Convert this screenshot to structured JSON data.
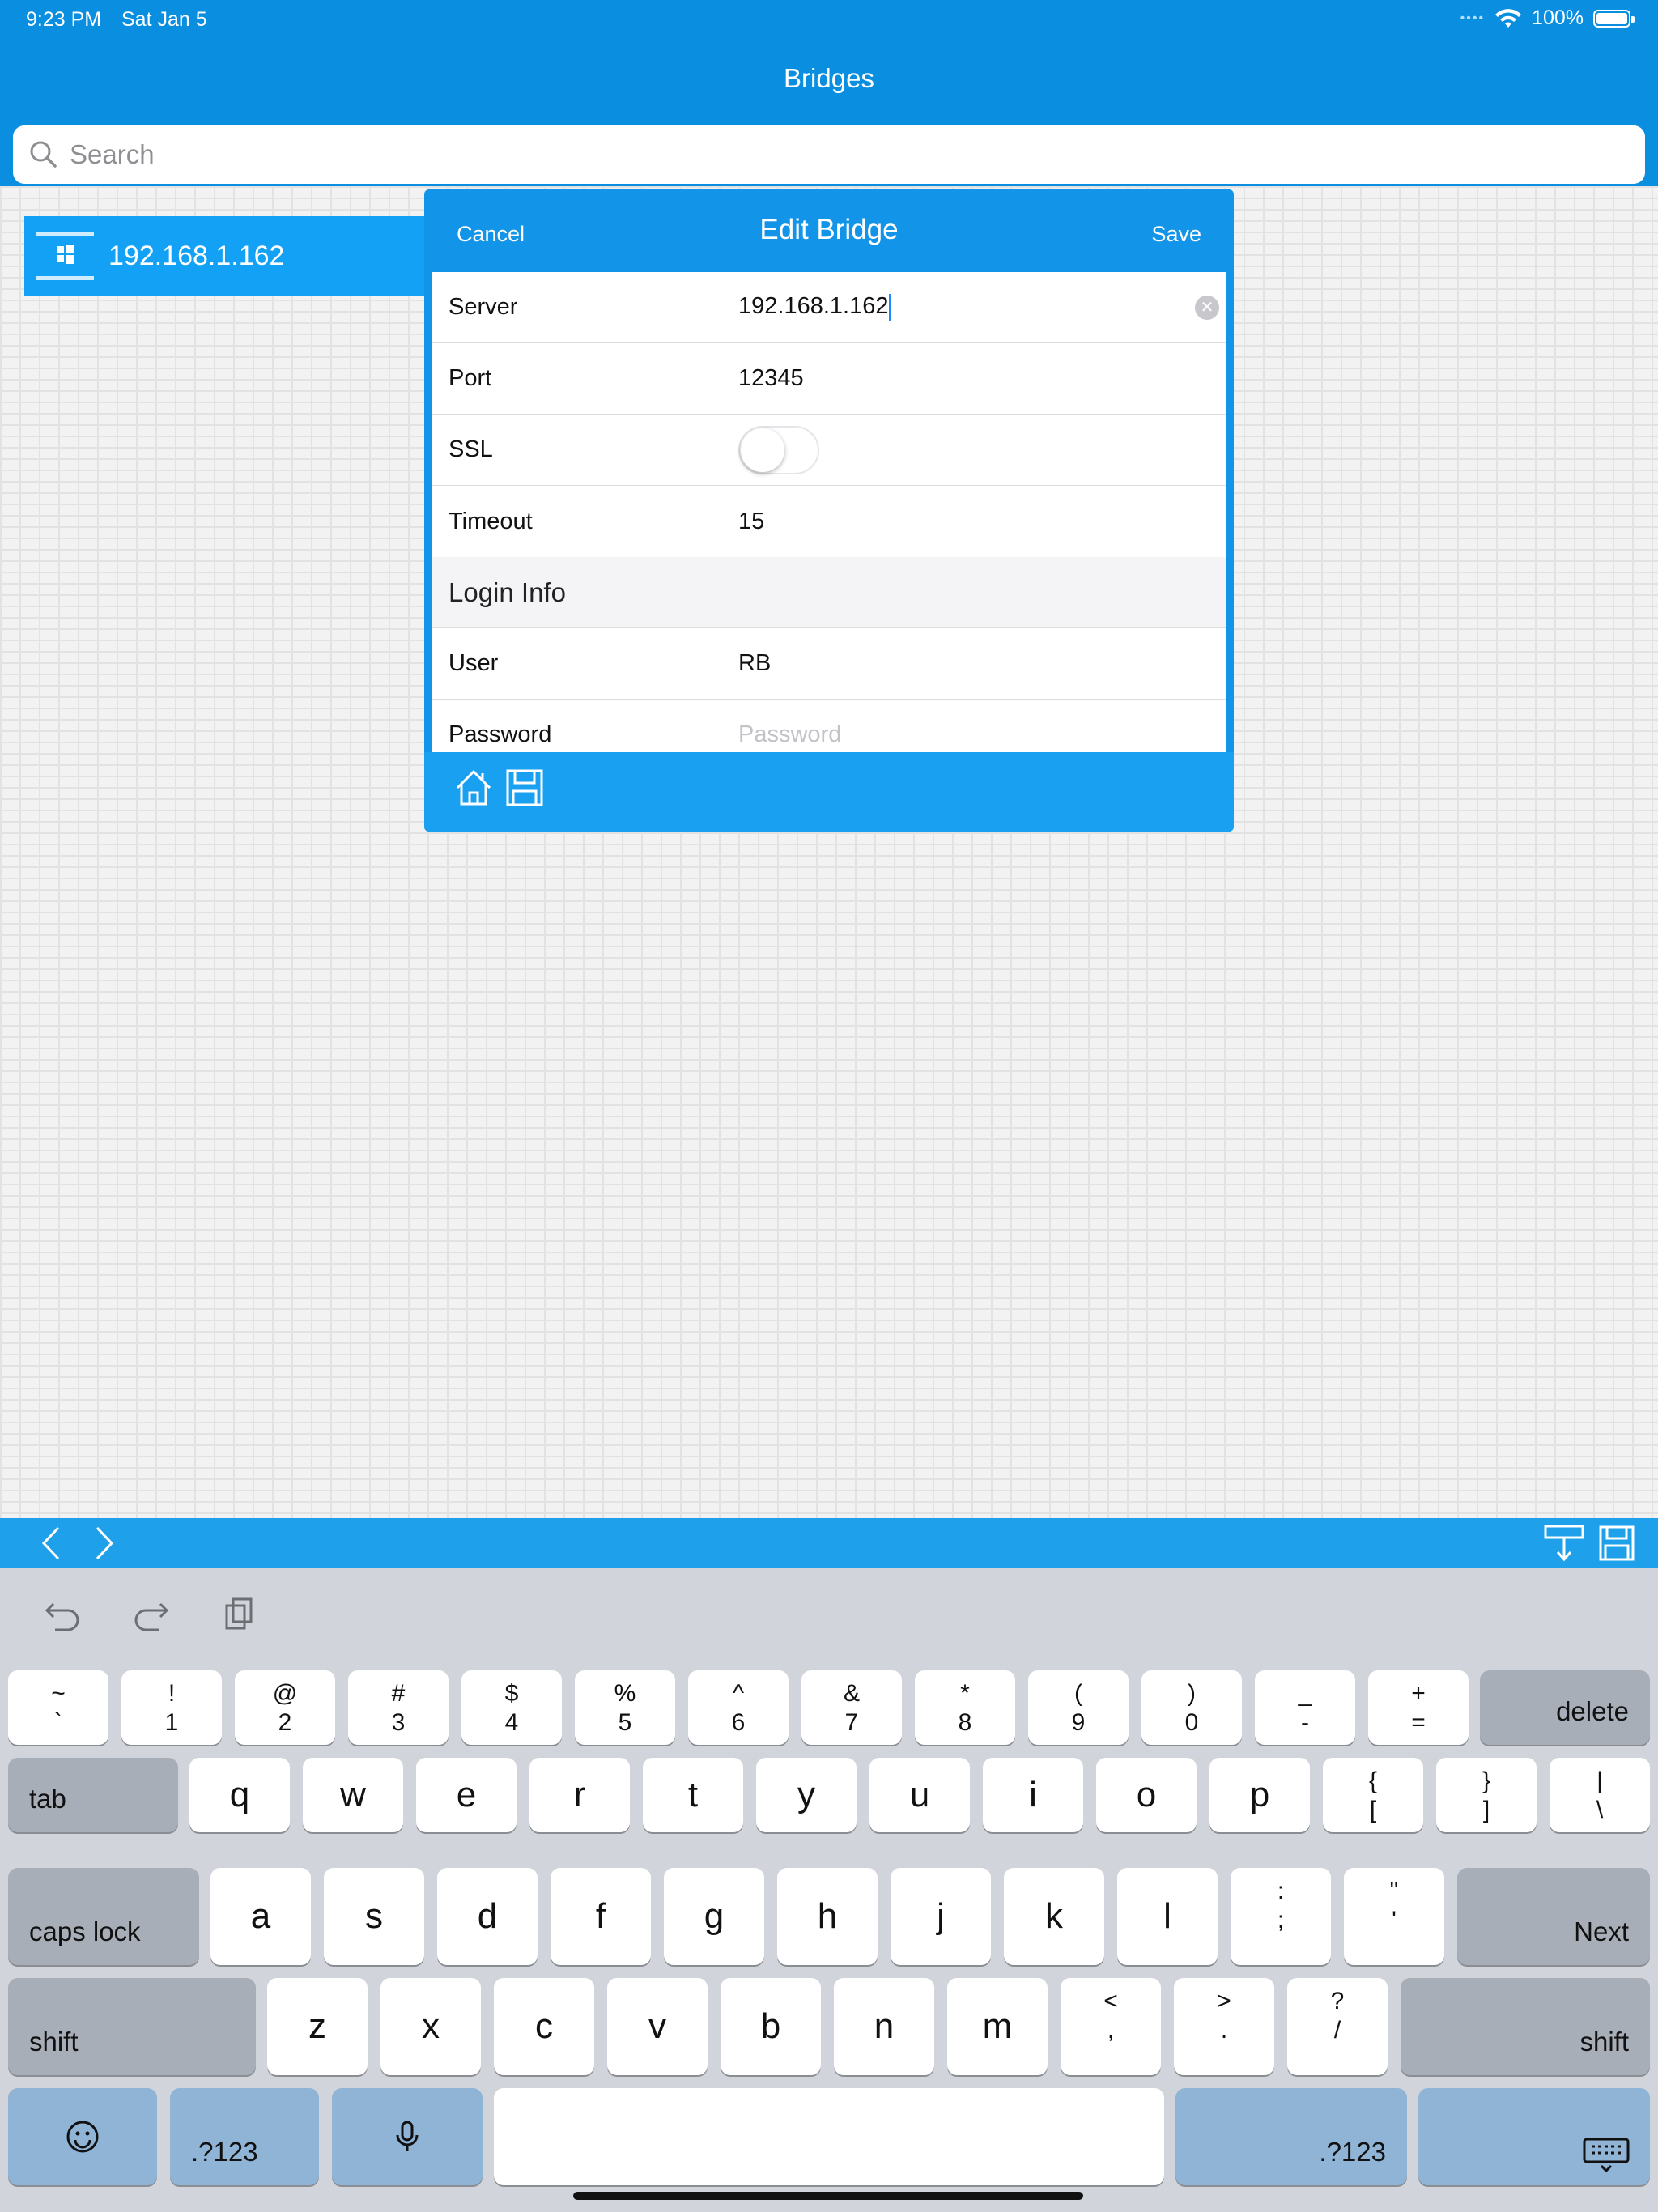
{
  "status": {
    "time": "9:23 PM",
    "date": "Sat Jan 5",
    "battery": "100%"
  },
  "nav": {
    "title": "Bridges"
  },
  "search": {
    "placeholder": "Search"
  },
  "bridges": [
    {
      "label": "192.168.1.162"
    }
  ],
  "modal": {
    "title": "Edit Bridge",
    "cancel_label": "Cancel",
    "save_label": "Save",
    "server_label": "Server",
    "server_value": "192.168.1.162",
    "port_label": "Port",
    "port_value": "12345",
    "ssl_label": "SSL",
    "ssl_on": false,
    "timeout_label": "Timeout",
    "timeout_value": "15",
    "login_section": "Login Info",
    "user_label": "User",
    "user_value": "RB",
    "password_label": "Password",
    "password_placeholder": "Password"
  },
  "keyboard": {
    "row1": [
      {
        "top": "~",
        "bot": "`"
      },
      {
        "top": "!",
        "bot": "1"
      },
      {
        "top": "@",
        "bot": "2"
      },
      {
        "top": "#",
        "bot": "3"
      },
      {
        "top": "$",
        "bot": "4"
      },
      {
        "top": "%",
        "bot": "5"
      },
      {
        "top": "^",
        "bot": "6"
      },
      {
        "top": "&",
        "bot": "7"
      },
      {
        "top": "*",
        "bot": "8"
      },
      {
        "top": "(",
        "bot": "9"
      },
      {
        "top": ")",
        "bot": "0"
      },
      {
        "top": "_",
        "bot": "-"
      },
      {
        "top": "+",
        "bot": "="
      }
    ],
    "delete_label": "delete",
    "tab_label": "tab",
    "row2": [
      "q",
      "w",
      "e",
      "r",
      "t",
      "y",
      "u",
      "i",
      "o",
      "p"
    ],
    "row2_symbols": [
      {
        "top": "{",
        "bot": "["
      },
      {
        "top": "}",
        "bot": "]"
      },
      {
        "top": "|",
        "bot": "\\"
      }
    ],
    "capslock_label": "caps lock",
    "row3": [
      "a",
      "s",
      "d",
      "f",
      "g",
      "h",
      "j",
      "k",
      "l"
    ],
    "row3_symbols": [
      {
        "top": ":",
        "bot": ";"
      },
      {
        "top": "\"",
        "bot": "'"
      }
    ],
    "next_label": "Next",
    "shift_label": "shift",
    "row4": [
      "z",
      "x",
      "c",
      "v",
      "b",
      "n",
      "m"
    ],
    "row4_symbols": [
      {
        "top": "<",
        "bot": ","
      },
      {
        "top": ">",
        "bot": "."
      },
      {
        "top": "?",
        "bot": "/"
      }
    ],
    "numbers_label": ".?123"
  }
}
